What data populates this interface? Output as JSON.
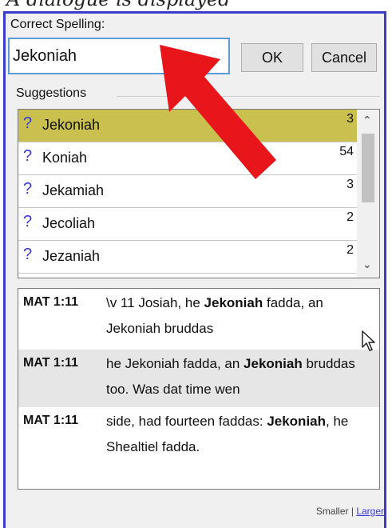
{
  "caption": "A dialogue is displayed",
  "dialog": {
    "correct_label": "Correct Spelling:",
    "correct_value": "Jekoniah",
    "ok_label": "OK",
    "cancel_label": "Cancel",
    "suggestions_label": "Suggestions",
    "suggestions": [
      {
        "icon": "?",
        "word": "Jekoniah",
        "count": "3",
        "selected": true
      },
      {
        "icon": "?",
        "word": "Koniah",
        "count": "54",
        "selected": false
      },
      {
        "icon": "?",
        "word": "Jekamiah",
        "count": "3",
        "selected": false
      },
      {
        "icon": "?",
        "word": "Jecoliah",
        "count": "2",
        "selected": false
      },
      {
        "icon": "?",
        "word": "Jezaniah",
        "count": "2",
        "selected": false
      }
    ],
    "references": [
      {
        "ref": "MAT 1:11",
        "pre": "\\v 11 Josiah, he ",
        "bold": "Jekoniah",
        "post": " fadda, an Jekoniah bruddas"
      },
      {
        "ref": "MAT 1:11",
        "pre": "he Jekoniah fadda, an ",
        "bold": "Jekoniah",
        "post": " bruddas too. Was dat time wen"
      },
      {
        "ref": "MAT 1:11",
        "pre": "side, had fourteen faddas: ",
        "bold": "Jekoniah",
        "post": ", he Shealtiel fadda."
      }
    ],
    "footer": {
      "smaller": "Smaller",
      "separator": "|",
      "larger": "Larger"
    }
  },
  "colors": {
    "selection": "#c9c04f",
    "arrow": "#e8151b",
    "accent": "#3a3ad6",
    "frame": "#3b3bcc"
  }
}
